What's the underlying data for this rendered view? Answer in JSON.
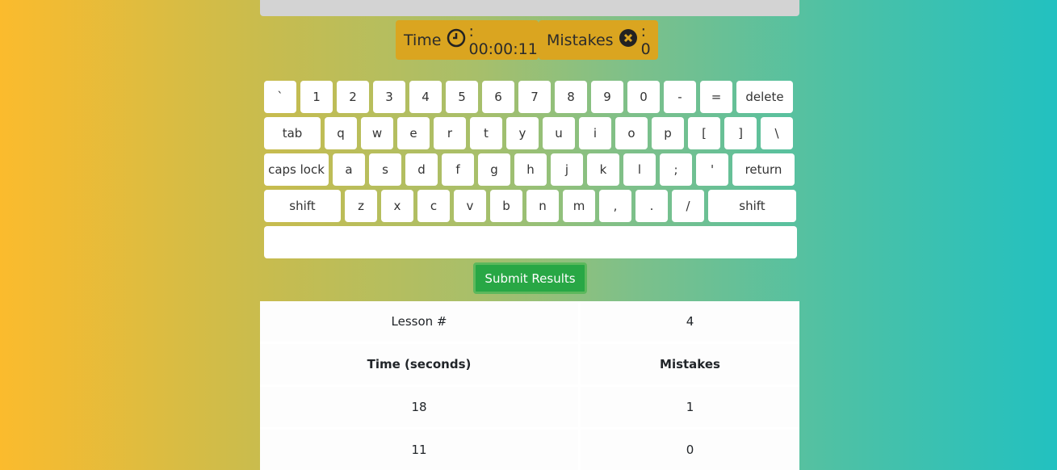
{
  "stats": {
    "time_label": "Time",
    "time_value": ": 00:00:11",
    "mistakes_label": "Mistakes",
    "mistakes_value": ": 0"
  },
  "keyboard": {
    "row1": [
      "`",
      "1",
      "2",
      "3",
      "4",
      "5",
      "6",
      "7",
      "8",
      "9",
      "0",
      "-",
      "=",
      "delete"
    ],
    "row2": [
      "tab",
      "q",
      "w",
      "e",
      "r",
      "t",
      "y",
      "u",
      "i",
      "o",
      "p",
      "[",
      "]",
      "\\"
    ],
    "row3": [
      "caps lock",
      "a",
      "s",
      "d",
      "f",
      "g",
      "h",
      "j",
      "k",
      "l",
      ";",
      "'",
      "return"
    ],
    "row4": [
      "shift",
      "z",
      "x",
      "c",
      "v",
      "b",
      "n",
      "m",
      ",",
      ".",
      "/",
      "shift"
    ],
    "space": ""
  },
  "submit_label": "Submit Results",
  "results": {
    "lesson_label": "Lesson #",
    "lesson_value": "4",
    "headers": [
      "Time (seconds)",
      "Mistakes"
    ],
    "rows": [
      [
        "18",
        "1"
      ],
      [
        "11",
        "0"
      ]
    ]
  },
  "colors": {
    "stat_bg": "#daa520",
    "submit_bg": "#28a745"
  }
}
